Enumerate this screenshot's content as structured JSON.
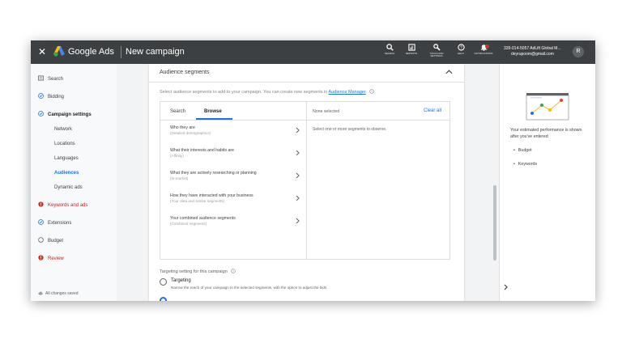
{
  "topbar": {
    "close_glyph": "✕",
    "brand": "Google Ads",
    "page_title": "New campaign",
    "tools": [
      {
        "label": "SEARCH",
        "icon": "search-icon"
      },
      {
        "label": "REPORTS",
        "icon": "reports-icon"
      },
      {
        "label": "TOOLS AND SETTINGS",
        "icon": "wrench-icon"
      },
      {
        "label": "HELP",
        "icon": "help-icon"
      },
      {
        "label": "NOTIFICATIONS",
        "icon": "bell-icon"
      }
    ],
    "account_id": "339-014-5057 AdLift Global M...",
    "account_email": "deyrupoom@gmail.com",
    "avatar_initial": "R"
  },
  "sidebar": {
    "items": [
      {
        "label": "Search",
        "icon": "search-campaign-icon"
      },
      {
        "label": "Bidding",
        "icon": "check-circle-icon"
      },
      {
        "label": "Campaign settings",
        "icon": "check-circle-icon"
      },
      {
        "label": "Network"
      },
      {
        "label": "Locations"
      },
      {
        "label": "Languages"
      },
      {
        "label": "Audiences"
      },
      {
        "label": "Dynamic ads"
      },
      {
        "label": "Keywords and ads",
        "icon": "error-icon"
      },
      {
        "label": "Extensions",
        "icon": "check-circle-icon"
      },
      {
        "label": "Budget",
        "icon": "empty-circle-icon"
      },
      {
        "label": "Review",
        "icon": "error-icon"
      }
    ],
    "saved": "All changes saved"
  },
  "card": {
    "title": "Audience segments",
    "description_pre": "Select audience segments to add to your campaign. You can create new segments in ",
    "description_link": "Audience Manager",
    "tabs": [
      "Search",
      "Browse"
    ],
    "browse_items": [
      {
        "title": "Who they are",
        "sub": "(Detailed demographics)"
      },
      {
        "title": "What their interests and habits are",
        "sub": "(Affinity)"
      },
      {
        "title": "What they are actively researching or planning",
        "sub": "(In-market)"
      },
      {
        "title": "How they have interacted with your business",
        "sub": "(Your data and similar segments)"
      },
      {
        "title": "Your combined audience segments",
        "sub": "(Combined segments)"
      }
    ],
    "none_selected": "None selected",
    "clear_all": "Clear all",
    "select_hint": "Select one or more segments to observe.",
    "targeting_setting": "Targeting setting for this campaign",
    "targeting_label": "Targeting",
    "targeting_desc": "Narrow the reach of your campaign to the selected segments, with the option to adjust the bids"
  },
  "right_panel": {
    "estimate_text": "Your estimated performance is shown after you've entered",
    "bullets": [
      "Budget",
      "Keywords"
    ]
  },
  "colors": {
    "accent": "#1a73e8",
    "topbar": "#3c4043",
    "error": "#c5221f"
  }
}
